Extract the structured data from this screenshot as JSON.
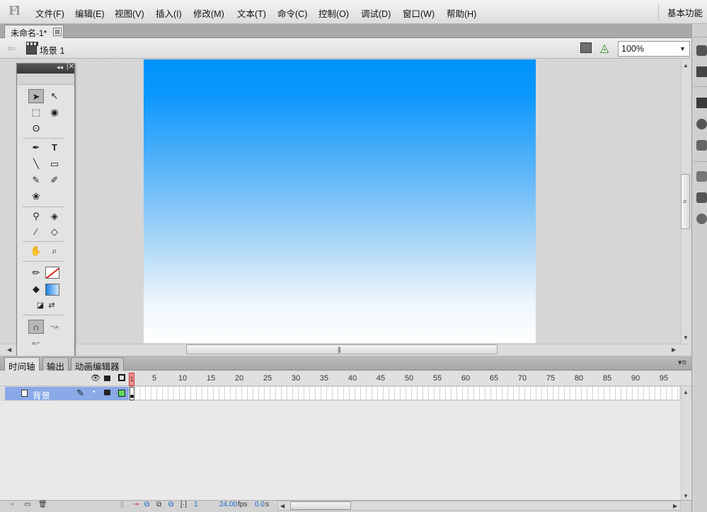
{
  "app": {
    "logo": "Fl"
  },
  "menu": [
    "文件(F)",
    "编辑(E)",
    "视图(V)",
    "插入(I)",
    "修改(M)",
    "文本(T)",
    "命令(C)",
    "控制(O)",
    "调试(D)",
    "窗口(W)",
    "帮助(H)"
  ],
  "workspace_label": "基本功能",
  "document": {
    "tab_title": "未命名-1*",
    "close_glyph": "⊠"
  },
  "editbar": {
    "scene_label": "场景 1",
    "zoom": "100%"
  },
  "timeline": {
    "tabs": [
      "时间轴",
      "输出",
      "动画编辑器"
    ],
    "frame_labels": [
      "1",
      "5",
      "10",
      "15",
      "20",
      "25",
      "30",
      "35",
      "40",
      "45",
      "50",
      "55",
      "60",
      "65",
      "70",
      "75",
      "80",
      "85",
      "90",
      "95"
    ],
    "playhead_frame": "1",
    "layer": {
      "name": "背景"
    },
    "footer": {
      "current_frame": "1",
      "fps": "24.00",
      "fps_unit": "fps",
      "time": "0.0",
      "time_unit": "s"
    }
  },
  "stage": {
    "gradient_top": "#0094fb",
    "gradient_bottom": "#ffffff"
  },
  "tools": [
    {
      "name": "selection-tool-icon",
      "glyph": "➤",
      "selected": true
    },
    {
      "name": "subselection-tool-icon",
      "glyph": "↖"
    },
    {
      "name": "free-transform-tool-icon",
      "glyph": "⬚"
    },
    {
      "name": "3d-rotation-tool-icon",
      "glyph": "◉"
    },
    {
      "name": "lasso-tool-icon",
      "glyph": "ʘ"
    },
    {
      "name": "pen-tool-icon",
      "glyph": "✒"
    },
    {
      "name": "text-tool-icon",
      "glyph": "T"
    },
    {
      "name": "line-tool-icon",
      "glyph": "╲"
    },
    {
      "name": "rectangle-tool-icon",
      "glyph": "▭"
    },
    {
      "name": "pencil-tool-icon",
      "glyph": "✎"
    },
    {
      "name": "brush-tool-icon",
      "glyph": "✐"
    },
    {
      "name": "deco-tool-icon",
      "glyph": "❀"
    },
    {
      "name": "bone-tool-icon",
      "glyph": "⚲"
    },
    {
      "name": "paint-bucket-tool-icon",
      "glyph": "◈"
    },
    {
      "name": "eyedropper-tool-icon",
      "glyph": "⁄"
    },
    {
      "name": "eraser-tool-icon",
      "glyph": "◇"
    },
    {
      "name": "hand-tool-icon",
      "glyph": "✋"
    },
    {
      "name": "zoom-tool-icon",
      "glyph": "⌕"
    },
    {
      "name": "stroke-color-icon",
      "glyph": "✏"
    },
    {
      "name": "fill-color-icon",
      "glyph": "◆"
    },
    {
      "name": "black-white-icon",
      "glyph": "◪"
    },
    {
      "name": "swap-colors-icon",
      "glyph": "⇄"
    },
    {
      "name": "snap-to-objects-icon",
      "glyph": "∩"
    },
    {
      "name": "smooth-icon",
      "glyph": "↝"
    },
    {
      "name": "straighten-icon",
      "glyph": "↜"
    }
  ]
}
